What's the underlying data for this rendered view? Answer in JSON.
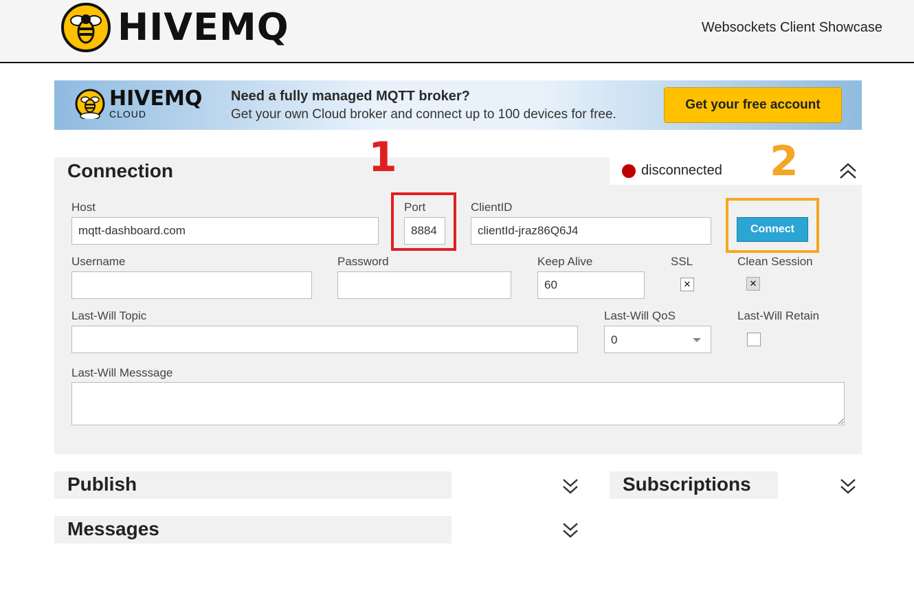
{
  "header": {
    "logo_text": "HIVEMQ",
    "showcase": "Websockets Client Showcase"
  },
  "banner": {
    "brand": "HIVEMQ",
    "brand_sub": "CLOUD",
    "headline": "Need a fully managed MQTT broker?",
    "subline": "Get your own Cloud broker and connect up to 100 devices for free.",
    "cta": "Get your free account"
  },
  "connection": {
    "title": "Connection",
    "status": "disconnected",
    "status_color": "#c00000",
    "host_label": "Host",
    "host_value": "mqtt-dashboard.com",
    "port_label": "Port",
    "port_value": "8884",
    "clientid_label": "ClientID",
    "clientid_value": "clientId-jraz86Q6J4",
    "connect_label": "Connect",
    "username_label": "Username",
    "username_value": "",
    "password_label": "Password",
    "password_value": "",
    "keepalive_label": "Keep Alive",
    "keepalive_value": "60",
    "ssl_label": "SSL",
    "ssl_checked": true,
    "clean_label": "Clean Session",
    "clean_checked": true,
    "lwtopic_label": "Last-Will Topic",
    "lwtopic_value": "",
    "lwqos_label": "Last-Will QoS",
    "lwqos_value": "0",
    "lwretain_label": "Last-Will Retain",
    "lwretain_checked": false,
    "lwmessage_label": "Last-Will Messsage",
    "lwmessage_value": ""
  },
  "sections": {
    "publish": "Publish",
    "subscriptions": "Subscriptions",
    "messages": "Messages"
  },
  "annotations": {
    "one": "1",
    "one_color": "#e02020",
    "two": "2",
    "two_color": "#f5a623"
  },
  "icons": {
    "check_mark": "✕"
  }
}
